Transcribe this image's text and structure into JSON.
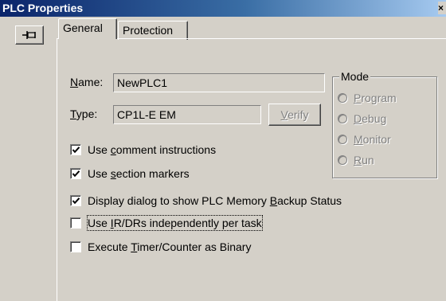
{
  "window": {
    "title": "PLC Properties",
    "close_glyph": "×"
  },
  "pin_button": {
    "icon": "pin-icon"
  },
  "tabs": [
    {
      "label": "General",
      "active": true
    },
    {
      "label": "Protection",
      "active": false
    }
  ],
  "general": {
    "name_label_accel": "N",
    "name_label_rest": "ame:",
    "name_value": "NewPLC1",
    "type_label_accel": "T",
    "type_label_rest": "ype:",
    "type_value": "CP1L-E EM",
    "verify_accel": "V",
    "verify_rest": "erify"
  },
  "mode": {
    "legend": "Mode",
    "options": [
      {
        "accel": "P",
        "rest": "rogram"
      },
      {
        "accel": "D",
        "rest": "ebug"
      },
      {
        "accel": "M",
        "rest": "onitor"
      },
      {
        "accel": "R",
        "rest": "un"
      }
    ]
  },
  "options": [
    {
      "pre": "Use ",
      "accel": "c",
      "post": "omment instructions",
      "checked": true
    },
    {
      "pre": "Use ",
      "accel": "s",
      "post": "ection markers",
      "checked": true
    },
    {
      "pre": "Display dialog to show PLC Memory ",
      "accel": "B",
      "post": "ackup Status",
      "checked": true
    },
    {
      "pre": "Use ",
      "accel": "I",
      "post": "R/DRs independently per task",
      "checked": false
    },
    {
      "pre": "Execute ",
      "accel": "T",
      "post": "imer/Counter as Binary",
      "checked": false
    }
  ]
}
